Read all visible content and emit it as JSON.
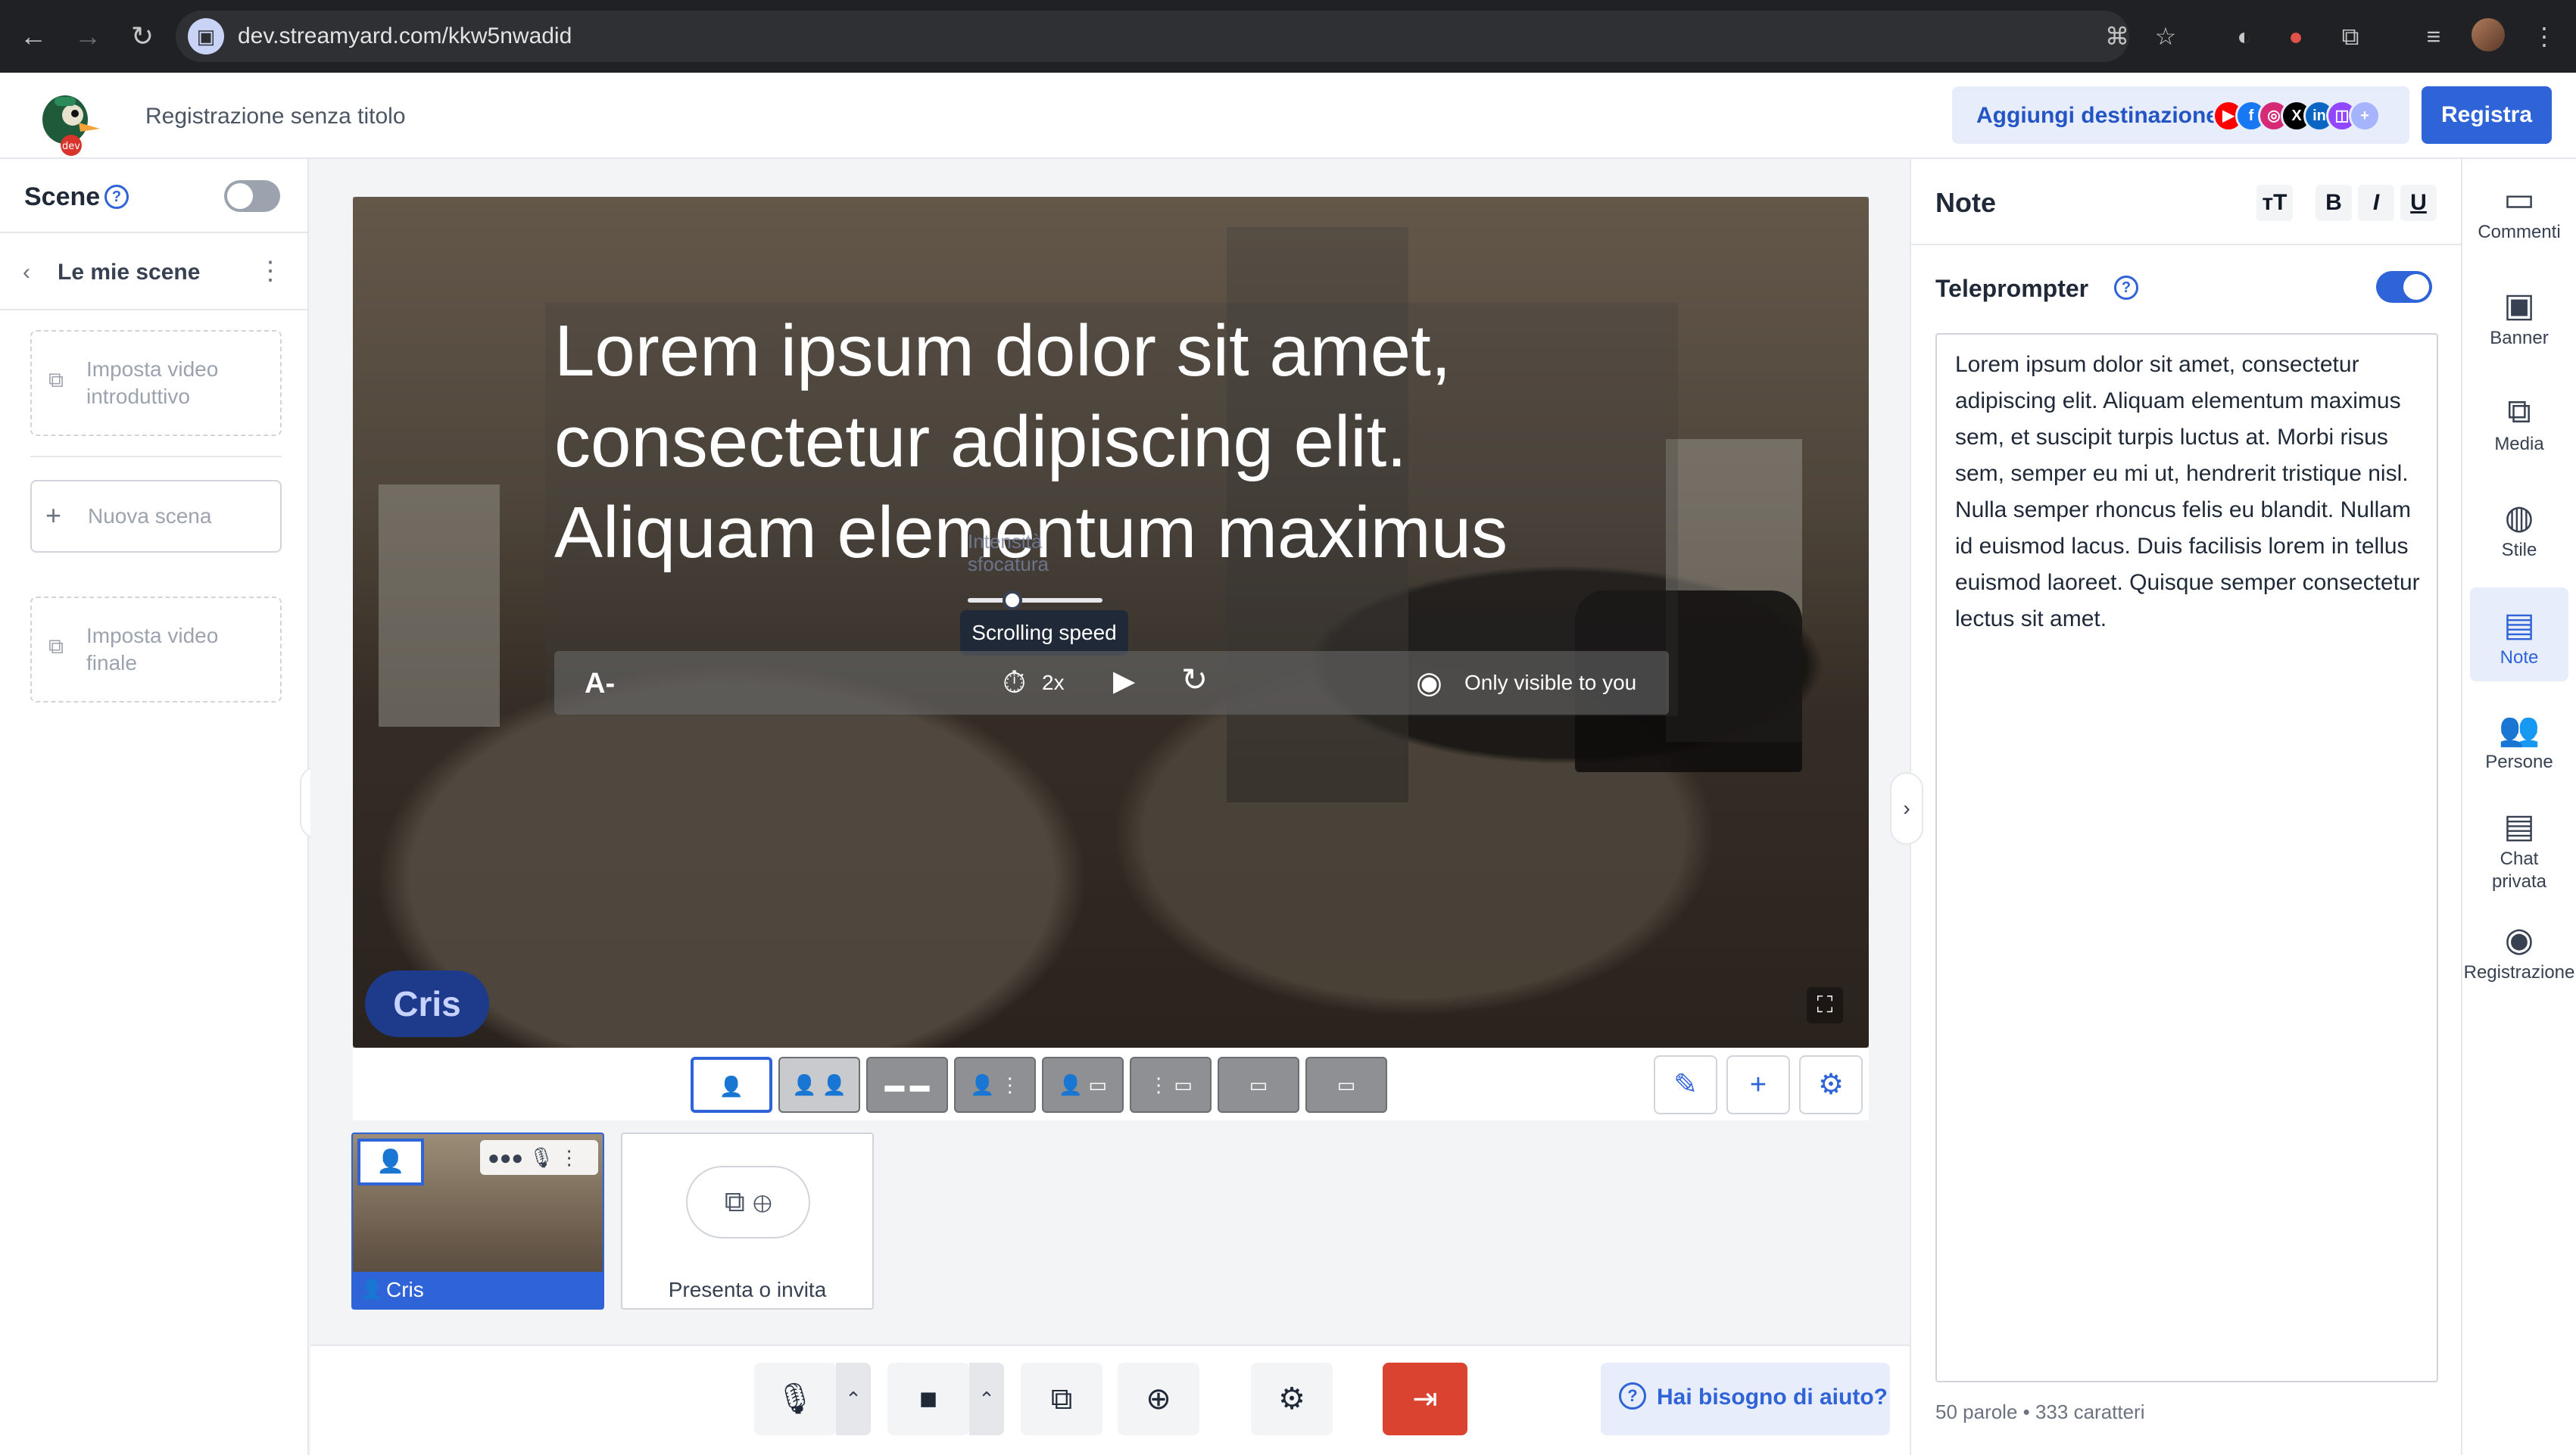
{
  "browser": {
    "url": "dev.streamyard.com/kkw5nwadid",
    "nav_icons": [
      "back-icon",
      "forward-icon",
      "reload-icon"
    ],
    "extension_icons": [
      "translate-icon",
      "star-icon",
      "extension-a-icon",
      "extension-b-icon",
      "puzzle-icon",
      "media-icon",
      "profile-avatar"
    ]
  },
  "header": {
    "logo_badge": "dev",
    "title": "Registrazione senza titolo",
    "add_destination_label": "Aggiungi destinazione",
    "destination_icons": [
      {
        "name": "youtube-icon",
        "glyph": "▶",
        "color": "#ff0000"
      },
      {
        "name": "facebook-icon",
        "glyph": "f",
        "color": "#1877f2"
      },
      {
        "name": "instagram-icon",
        "glyph": "◎",
        "color": "#d62976"
      },
      {
        "name": "x-icon",
        "glyph": "X",
        "color": "#000000"
      },
      {
        "name": "linkedin-icon",
        "glyph": "in",
        "color": "#0a66c2"
      },
      {
        "name": "twitch-icon",
        "glyph": "◫",
        "color": "#9146ff"
      },
      {
        "name": "add-destination-icon",
        "glyph": "+",
        "color": "#a5b4fc"
      }
    ],
    "record_label": "Registra",
    "accent": "#2f63d8"
  },
  "scenes": {
    "title": "Scene",
    "help": "?",
    "my_scenes_label": "Le mie scene",
    "intro_video_label": "Imposta video introduttivo",
    "new_scene_label": "Nuova scena",
    "outro_video_label": "Imposta video finale"
  },
  "stage": {
    "teleprompter_lines": [
      "Lorem ipsum dolor sit amet,",
      "consectetur adipiscing elit.",
      "Aliquam elementum maximus"
    ],
    "font_decrease_label": "A-",
    "blur_label": "Intensità sfocatura",
    "scrolling_speed_tooltip": "Scrolling speed",
    "speed_value": "2x",
    "visibility_label": "Only visible to you",
    "name_tag": "Cris"
  },
  "layouts": [
    "solo",
    "two-up",
    "two-small",
    "group",
    "side-by-side",
    "list",
    "thumbnail",
    "blank"
  ],
  "guests": {
    "name": "Cris",
    "invite_label": "Presenta o invita"
  },
  "controls": {
    "help_label": "Hai bisogno di aiuto?"
  },
  "notes": {
    "title": "Note",
    "format_buttons": [
      "тT",
      "B",
      "I",
      "U"
    ],
    "teleprompter_label": "Teleprompter",
    "teleprompter_enabled": true,
    "text": "Lorem ipsum dolor sit amet, consectetur adipiscing elit. Aliquam elementum maximus sem, et suscipit turpis luctus at. Morbi risus sem, semper eu mi ut, hendrerit tristique nisl. Nulla semper rhoncus felis eu blandit. Nullam id euismod lacus. Duis facilisis lorem in tellus euismod laoreet. Quisque semper consectetur lectus sit amet.",
    "word_count": "50 parole • 333 caratteri"
  },
  "right_nav": [
    {
      "label": "Commenti",
      "icon": "comments-icon"
    },
    {
      "label": "Banner",
      "icon": "banner-icon"
    },
    {
      "label": "Media",
      "icon": "media-library-icon"
    },
    {
      "label": "Stile",
      "icon": "palette-icon"
    },
    {
      "label": "Note",
      "icon": "notes-icon",
      "active": true
    },
    {
      "label": "Persone",
      "icon": "people-icon"
    },
    {
      "label": "Chat privata",
      "icon": "private-chat-icon"
    },
    {
      "label": "Registrazione",
      "icon": "recording-icon"
    }
  ]
}
